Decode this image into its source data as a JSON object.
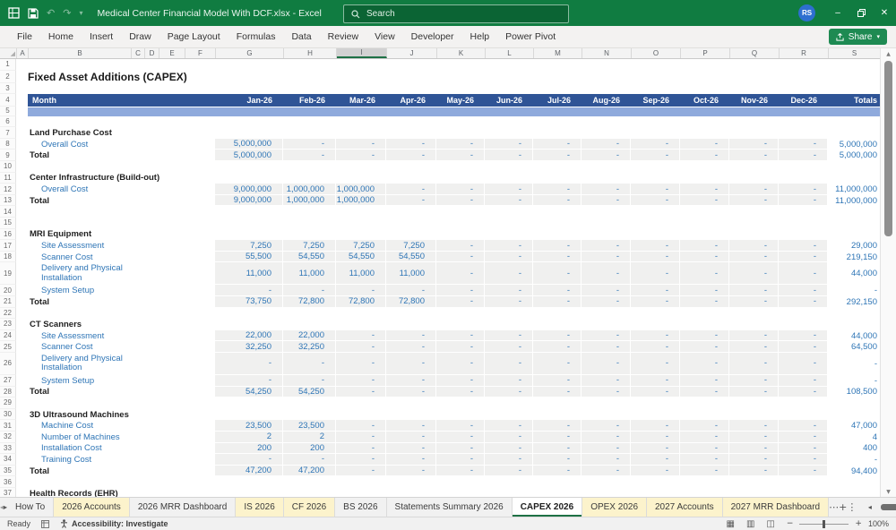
{
  "titlebar": {
    "title": "Medical Center  Financial Model With DCF.xlsx  -  Excel",
    "search_placeholder": "Search",
    "avatar": "RS"
  },
  "ribbon": {
    "tabs": [
      "File",
      "Home",
      "Insert",
      "Draw",
      "Page Layout",
      "Formulas",
      "Data",
      "Review",
      "View",
      "Developer",
      "Help",
      "Power Pivot"
    ],
    "share_label": "Share"
  },
  "grid": {
    "columns": [
      "A",
      "B",
      "C",
      "D",
      "E",
      "F",
      "G",
      "H",
      "I",
      "J",
      "K",
      "L",
      "M",
      "N",
      "O",
      "P",
      "Q",
      "R",
      "S"
    ],
    "selected_column": "I"
  },
  "sheet": {
    "title": "Fixed Asset Additions (CAPEX)",
    "header": {
      "label": "Month",
      "months": [
        "Jan-26",
        "Feb-26",
        "Mar-26",
        "Apr-26",
        "May-26",
        "Jun-26",
        "Jul-26",
        "Aug-26",
        "Sep-26",
        "Oct-26",
        "Nov-26",
        "Dec-26"
      ],
      "totals_label": "Totals"
    },
    "rows": [
      {
        "n": 1,
        "type": "blank"
      },
      {
        "n": 2,
        "type": "title",
        "label": "Fixed Asset Additions (CAPEX)"
      },
      {
        "n": 3,
        "type": "blank"
      },
      {
        "n": 4,
        "type": "header"
      },
      {
        "n": 5,
        "type": "band"
      },
      {
        "n": 6,
        "type": "blank"
      },
      {
        "n": 7,
        "type": "section",
        "label": "Land Purchase Cost"
      },
      {
        "n": 8,
        "type": "item",
        "label": "Overall Cost",
        "values": [
          "5,000,000",
          "-",
          "-",
          "-",
          "-",
          "-",
          "-",
          "-",
          "-",
          "-",
          "-",
          "-"
        ],
        "total": "5,000,000"
      },
      {
        "n": 9,
        "type": "total",
        "label": "Total",
        "values": [
          "5,000,000",
          "-",
          "-",
          "-",
          "-",
          "-",
          "-",
          "-",
          "-",
          "-",
          "-",
          "-"
        ],
        "total": "5,000,000"
      },
      {
        "n": 10,
        "type": "blank"
      },
      {
        "n": 11,
        "type": "section",
        "label": "Center Infrastructure (Build-out)"
      },
      {
        "n": 12,
        "type": "item",
        "label": "Overall Cost",
        "values": [
          "9,000,000",
          "1,000,000",
          "1,000,000",
          "-",
          "-",
          "-",
          "-",
          "-",
          "-",
          "-",
          "-",
          "-"
        ],
        "total": "11,000,000"
      },
      {
        "n": 13,
        "type": "total",
        "label": "Total",
        "values": [
          "9,000,000",
          "1,000,000",
          "1,000,000",
          "-",
          "-",
          "-",
          "-",
          "-",
          "-",
          "-",
          "-",
          "-"
        ],
        "total": "11,000,000"
      },
      {
        "n": 14,
        "type": "blank"
      },
      {
        "n": 15,
        "type": "blank"
      },
      {
        "n": 16,
        "type": "section",
        "label": "MRI Equipment"
      },
      {
        "n": 17,
        "type": "item",
        "label": "Site Assessment",
        "values": [
          "7,250",
          "7,250",
          "7,250",
          "7,250",
          "-",
          "-",
          "-",
          "-",
          "-",
          "-",
          "-",
          "-"
        ],
        "total": "29,000"
      },
      {
        "n": 18,
        "type": "item",
        "label": "Scanner Cost",
        "values": [
          "55,500",
          "54,550",
          "54,550",
          "54,550",
          "-",
          "-",
          "-",
          "-",
          "-",
          "-",
          "-",
          "-"
        ],
        "total": "219,150"
      },
      {
        "n": 19,
        "type": "item2",
        "label": "Delivery and Physical Installation",
        "values": [
          "11,000",
          "11,000",
          "11,000",
          "11,000",
          "-",
          "-",
          "-",
          "-",
          "-",
          "-",
          "-",
          "-"
        ],
        "total": "44,000"
      },
      {
        "n": 20,
        "type": "item",
        "label": "System Setup",
        "values": [
          "-",
          "-",
          "-",
          "-",
          "-",
          "-",
          "-",
          "-",
          "-",
          "-",
          "-",
          "-"
        ],
        "total": "-"
      },
      {
        "n": 21,
        "type": "total",
        "label": "Total",
        "values": [
          "73,750",
          "72,800",
          "72,800",
          "72,800",
          "-",
          "-",
          "-",
          "-",
          "-",
          "-",
          "-",
          "-"
        ],
        "total": "292,150"
      },
      {
        "n": 22,
        "type": "blank"
      },
      {
        "n": 23,
        "type": "section",
        "label": "CT Scanners"
      },
      {
        "n": 24,
        "type": "item",
        "label": "Site Assessment",
        "values": [
          "22,000",
          "22,000",
          "-",
          "-",
          "-",
          "-",
          "-",
          "-",
          "-",
          "-",
          "-",
          "-"
        ],
        "total": "44,000"
      },
      {
        "n": 25,
        "type": "item",
        "label": "Scanner Cost",
        "values": [
          "32,250",
          "32,250",
          "-",
          "-",
          "-",
          "-",
          "-",
          "-",
          "-",
          "-",
          "-",
          "-"
        ],
        "total": "64,500"
      },
      {
        "n": 26,
        "type": "item2",
        "label": "Delivery and Physical Installation",
        "values": [
          "-",
          "-",
          "-",
          "-",
          "-",
          "-",
          "-",
          "-",
          "-",
          "-",
          "-",
          "-"
        ],
        "total": "-"
      },
      {
        "n": 27,
        "type": "item",
        "label": "System Setup",
        "values": [
          "-",
          "-",
          "-",
          "-",
          "-",
          "-",
          "-",
          "-",
          "-",
          "-",
          "-",
          "-"
        ],
        "total": "-"
      },
      {
        "n": 28,
        "type": "total",
        "label": "Total",
        "values": [
          "54,250",
          "54,250",
          "-",
          "-",
          "-",
          "-",
          "-",
          "-",
          "-",
          "-",
          "-",
          "-"
        ],
        "total": "108,500"
      },
      {
        "n": 29,
        "type": "blank"
      },
      {
        "n": 30,
        "type": "section",
        "label": "3D Ultrasound Machines"
      },
      {
        "n": 31,
        "type": "item",
        "label": "Machine Cost",
        "values": [
          "23,500",
          "23,500",
          "-",
          "-",
          "-",
          "-",
          "-",
          "-",
          "-",
          "-",
          "-",
          "-"
        ],
        "total": "47,000"
      },
      {
        "n": 32,
        "type": "item",
        "label": "Number of Machines",
        "values": [
          "2",
          "2",
          "-",
          "-",
          "-",
          "-",
          "-",
          "-",
          "-",
          "-",
          "-",
          "-"
        ],
        "total": "4"
      },
      {
        "n": 33,
        "type": "item",
        "label": "Installation Cost",
        "values": [
          "200",
          "200",
          "-",
          "-",
          "-",
          "-",
          "-",
          "-",
          "-",
          "-",
          "-",
          "-"
        ],
        "total": "400"
      },
      {
        "n": 34,
        "type": "item",
        "label": "Training Cost",
        "values": [
          "-",
          "-",
          "-",
          "-",
          "-",
          "-",
          "-",
          "-",
          "-",
          "-",
          "-",
          "-"
        ],
        "total": "-"
      },
      {
        "n": 35,
        "type": "total",
        "label": "Total",
        "values": [
          "47,200",
          "47,200",
          "-",
          "-",
          "-",
          "-",
          "-",
          "-",
          "-",
          "-",
          "-",
          "-"
        ],
        "total": "94,400"
      },
      {
        "n": 36,
        "type": "blank"
      },
      {
        "n": 37,
        "type": "section",
        "label": "Health Records (EHR)"
      }
    ]
  },
  "tabs": {
    "items": [
      {
        "label": "How To",
        "color": "plain"
      },
      {
        "label": "2026 Accounts",
        "color": "yellow"
      },
      {
        "label": "2026 MRR Dashboard",
        "color": "plain"
      },
      {
        "label": "IS 2026",
        "color": "yellow"
      },
      {
        "label": "CF 2026",
        "color": "yellow"
      },
      {
        "label": "BS 2026",
        "color": "plain"
      },
      {
        "label": "Statements Summary 2026",
        "color": "plain"
      },
      {
        "label": "CAPEX 2026",
        "color": "active"
      },
      {
        "label": "OPEX 2026",
        "color": "yellow"
      },
      {
        "label": "2027 Accounts",
        "color": "yellow"
      },
      {
        "label": "2027 MRR Dashboard",
        "color": "yellow"
      }
    ]
  },
  "statusbar": {
    "ready": "Ready",
    "accessibility": "Accessibility: Investigate",
    "zoom": "100%"
  },
  "icons": {
    "undo": "↶",
    "redo": "↷",
    "caret": "▾",
    "minimize": "–",
    "close": "✕",
    "tab_prev": "◂",
    "tab_next": "▸",
    "more_sheets": "⋯",
    "add_sheet": "+",
    "sheet_menu": "⋮",
    "scroll_up": "▲",
    "scroll_down": "▼",
    "select_all": "◢",
    "view_normal": "▦",
    "view_layout": "▥",
    "view_break": "◫",
    "zoom_minus": "−",
    "zoom_plus": "+"
  },
  "colors": {
    "titlebar_green": "#107C41",
    "share_green": "#1E8A52",
    "header_blue": "#2F5496",
    "band_blue": "#8FAADC",
    "value_blue": "#2E75B6",
    "cell_gray": "#F0F0EF",
    "tab_yellow": "#FCF3CC",
    "active_green": "#1E7145"
  }
}
